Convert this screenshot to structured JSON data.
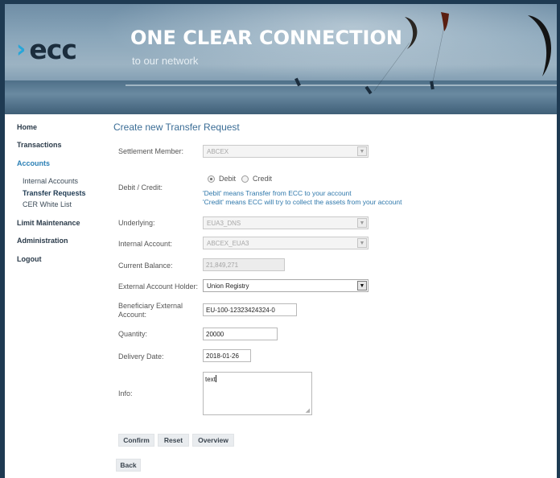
{
  "banner": {
    "logo_mark": "›",
    "logo_text": "ecc",
    "headline": "ONE CLEAR CONNECTION",
    "subline": "to our network"
  },
  "nav": {
    "main_items": [
      {
        "label": "Home"
      },
      {
        "label": "Transactions"
      },
      {
        "label": "Accounts"
      },
      {
        "label": "Limit Maintenance"
      },
      {
        "label": "Administration"
      },
      {
        "label": "Logout"
      }
    ],
    "accounts_sub": [
      {
        "label": "Internal Accounts"
      },
      {
        "label": "Transfer Requests"
      },
      {
        "label": "CER White List"
      }
    ]
  },
  "form": {
    "title": "Create new Transfer Request",
    "settlement_member": {
      "label": "Settlement Member:",
      "value": "ABCEX"
    },
    "debit_credit": {
      "label": "Debit / Credit:",
      "options": [
        "Debit",
        "Credit"
      ],
      "selected": "Debit",
      "hint_debit": "'Debit' means Transfer from ECC to your account",
      "hint_credit": "'Credit' means ECC will try to collect the assets from your account"
    },
    "underlying": {
      "label": "Underlying:",
      "value": "EUA3_DNS"
    },
    "internal_account": {
      "label": "Internal Account:",
      "value": "ABCEX_EUA3"
    },
    "current_balance": {
      "label": "Current Balance:",
      "value": "21,849,271"
    },
    "external_account_holder": {
      "label": "External Account Holder:",
      "value": "Union Registry"
    },
    "beneficiary_external_account": {
      "label_line1": "Beneficiary External",
      "label_line2": "Account:",
      "value": "EU-100-12323424324-0"
    },
    "quantity": {
      "label": "Quantity:",
      "value": "20000"
    },
    "delivery_date": {
      "label": "Delivery Date:",
      "value": "2018-01-26"
    },
    "info": {
      "label": "Info:",
      "value": "text"
    },
    "buttons": {
      "confirm": "Confirm",
      "reset": "Reset",
      "overview": "Overview",
      "back": "Back"
    }
  },
  "colors": {
    "frame": "#1e3a52",
    "accent": "#2a7fb5",
    "title": "#3b6d96",
    "hint": "#2f78ab",
    "logo_chevron": "#27a6d9"
  },
  "icons": {
    "dropdown": "dropdown-arrow-icon",
    "resize": "resize-grip-icon"
  }
}
